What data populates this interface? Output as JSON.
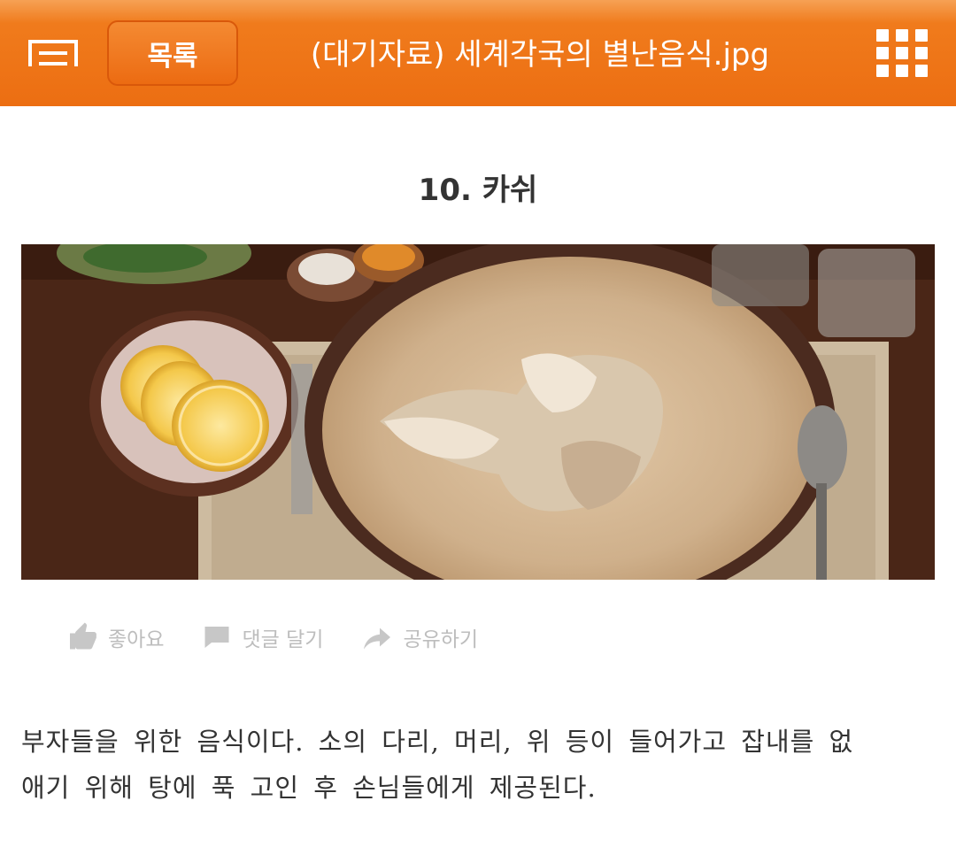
{
  "header": {
    "list_button": "목록",
    "title": "(대기자료) 세계각국의 별난음식.jpg",
    "menu_icon": "hamburger-menu-icon",
    "grid_icon": "grid-apps-icon",
    "accent": "#ef7516"
  },
  "article": {
    "heading": "10. 카쉬",
    "image_icon": "food-photo"
  },
  "actions": [
    {
      "label": "좋아요",
      "icon": "thumbs-up-icon"
    },
    {
      "label": "댓글 달기",
      "icon": "comment-icon"
    },
    {
      "label": "공유하기",
      "icon": "share-arrow-icon"
    }
  ],
  "description": {
    "line1": "부자들을 위한 음식이다. 소의 다리, 머리, 위 등이 들어가고 잡내를 없",
    "line2": "애기 위해 탕에 푹 고인 후 손님들에게 제공된다."
  }
}
